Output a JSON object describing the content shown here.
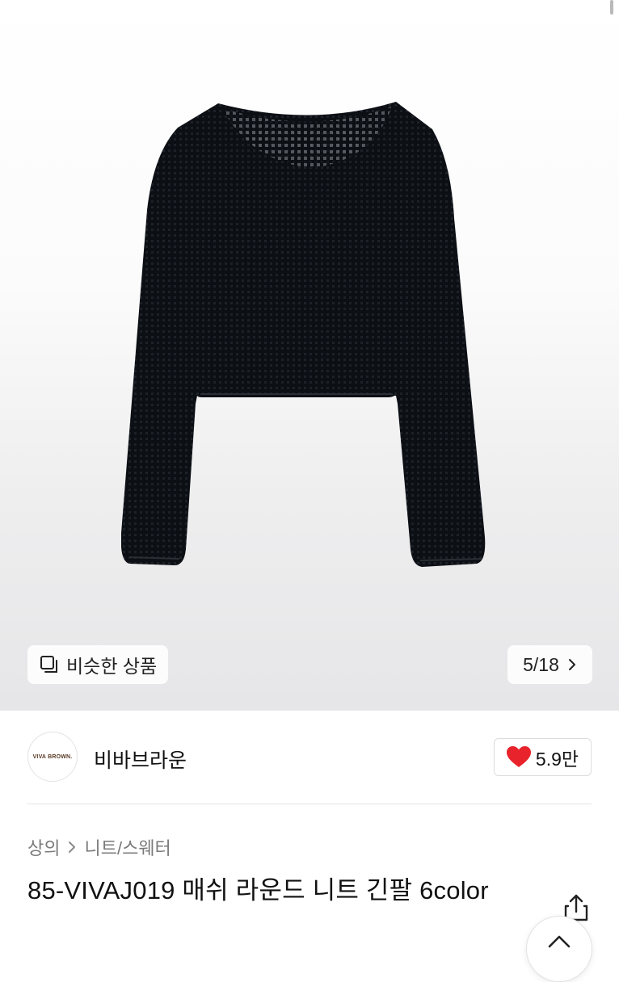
{
  "gallery": {
    "similar_label": "비슷한 상품",
    "page_indicator": "5/18"
  },
  "store": {
    "logo_text": "VIVA BROWN.",
    "name": "비바브라운",
    "likes": "5.9만"
  },
  "breadcrumb": {
    "category": "상의",
    "subcategory": "니트/스웨터"
  },
  "product": {
    "title": "85-VIVAJ019 매쉬 라운드 니트 긴팔 6color"
  },
  "colors": {
    "heart": "#e8232b",
    "sweater": "#0c0f14"
  }
}
